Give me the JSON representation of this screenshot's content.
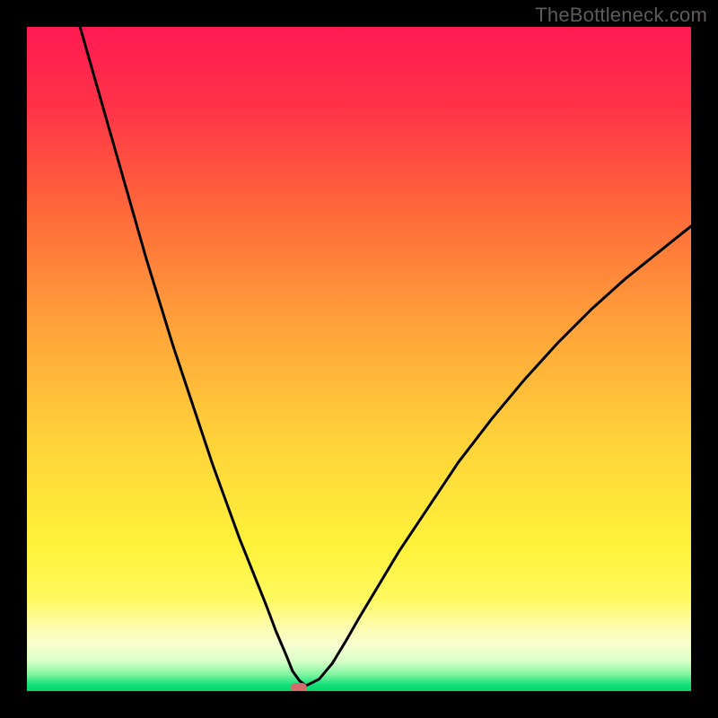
{
  "watermark": "TheBottleneck.com",
  "colors": {
    "frame": "#000000",
    "marker": "#d66b6b",
    "gradient_stops": [
      {
        "pos": 0.0,
        "color": "#ff1a52"
      },
      {
        "pos": 0.12,
        "color": "#ff3348"
      },
      {
        "pos": 0.28,
        "color": "#ff6a3a"
      },
      {
        "pos": 0.45,
        "color": "#ffa23a"
      },
      {
        "pos": 0.62,
        "color": "#ffd23a"
      },
      {
        "pos": 0.78,
        "color": "#fff23a"
      },
      {
        "pos": 0.86,
        "color": "#fff95e"
      },
      {
        "pos": 0.9,
        "color": "#fffca8"
      },
      {
        "pos": 0.93,
        "color": "#f7ffd0"
      },
      {
        "pos": 0.955,
        "color": "#d8ffc8"
      },
      {
        "pos": 0.975,
        "color": "#80f5a0"
      },
      {
        "pos": 0.99,
        "color": "#15e07a"
      },
      {
        "pos": 1.0,
        "color": "#06d468"
      }
    ]
  },
  "chart_data": {
    "type": "line",
    "title": "",
    "xlabel": "",
    "ylabel": "",
    "xlim": [
      0,
      100
    ],
    "ylim": [
      0,
      100
    ],
    "grid": false,
    "legend": false,
    "series": [
      {
        "name": "bottleneck-curve",
        "x": [
          8,
          10,
          12,
          14,
          16,
          18,
          20,
          22,
          24,
          26,
          28,
          30,
          32,
          34,
          36,
          37.5,
          39,
          40,
          41,
          42,
          44,
          46,
          48,
          50,
          53,
          56,
          60,
          65,
          70,
          75,
          80,
          85,
          90,
          95,
          100
        ],
        "y": [
          100,
          93,
          86,
          79,
          72,
          65,
          58.5,
          52,
          46,
          40,
          34,
          28.5,
          23,
          18,
          13,
          9,
          5.5,
          3,
          1.6,
          0.8,
          1.8,
          4.2,
          7.5,
          11,
          16,
          21,
          27,
          34.5,
          41,
          47,
          52.5,
          57.5,
          62,
          66,
          70
        ]
      }
    ],
    "marker": {
      "x": 41.0,
      "y": 0.5
    }
  }
}
